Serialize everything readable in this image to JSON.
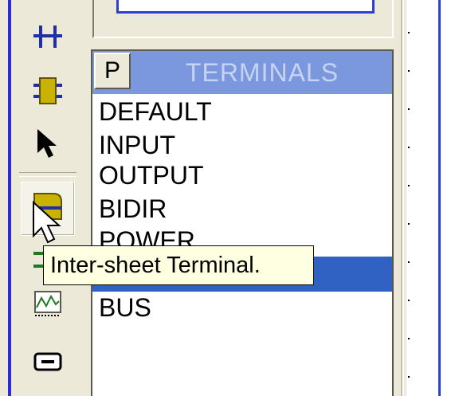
{
  "toolbar": {
    "tools": [
      {
        "name": "junction-dot-icon"
      },
      {
        "name": "component-icon"
      },
      {
        "name": "selection-pointer-icon"
      },
      {
        "name": "terminal-icon"
      },
      {
        "name": "subcircuit-icon"
      },
      {
        "name": "graph-icon"
      },
      {
        "name": "tape-icon"
      }
    ]
  },
  "terminals_panel": {
    "mode_button": "P",
    "title": "TERMINALS",
    "items": [
      "DEFAULT",
      "INPUT",
      "OUTPUT",
      "BIDIR",
      "POWER",
      "",
      "BUS"
    ],
    "selected_index": 5
  },
  "tooltip": {
    "text": "Inter-sheet Terminal."
  },
  "colors": {
    "header_bg": "#7b98de",
    "header_text": "#c6d3f2",
    "selection": "#2f62c2",
    "tooltip_bg": "#ffffe1",
    "sheet_border": "#2f3fd4"
  }
}
